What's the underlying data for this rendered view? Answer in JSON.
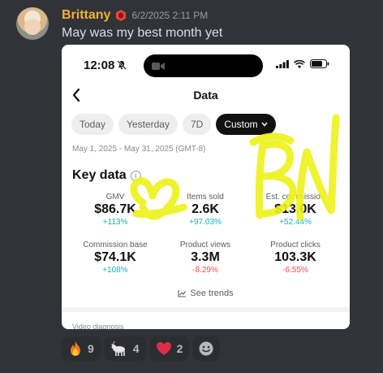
{
  "message": {
    "username": "Brittany",
    "timestamp": "6/2/2025 2:11 PM",
    "text": "May was my best month yet"
  },
  "screenshot": {
    "status_bar": {
      "time": "12:08"
    },
    "nav": {
      "title": "Data"
    },
    "tabs": [
      {
        "label": "Today"
      },
      {
        "label": "Yesterday"
      },
      {
        "label": "7D"
      },
      {
        "label": "Custom"
      }
    ],
    "date_range": "May 1, 2025 - May 31, 2025 (GMT-8)",
    "section_title": "Key data",
    "metrics": [
      {
        "label": "GMV",
        "value": "$86.7K",
        "change": "+113%",
        "direction": "up"
      },
      {
        "label": "Items sold",
        "value": "2.6K",
        "change": "+97.03%",
        "direction": "up"
      },
      {
        "label": "Est. commission",
        "value": "$13.0K",
        "change": "+52.44%",
        "direction": "up"
      },
      {
        "label": "Commission base",
        "value": "$74.1K",
        "change": "+108%",
        "direction": "up"
      },
      {
        "label": "Product views",
        "value": "3.3M",
        "change": "-8.29%",
        "direction": "down"
      },
      {
        "label": "Product clicks",
        "value": "103.3K",
        "change": "-6.55%",
        "direction": "down"
      }
    ],
    "see_trends": "See trends",
    "next_section": "Video diagnosis",
    "colors": {
      "positive": "#18b2b4",
      "negative": "#f04a4a",
      "scribble": "#eef218"
    }
  },
  "reactions": [
    {
      "icon": "fire-icon",
      "count": "9"
    },
    {
      "icon": "goat-icon",
      "count": "4"
    },
    {
      "icon": "heart-icon",
      "count": "2"
    }
  ],
  "colors": {
    "username": "#f0b232",
    "background": "#313338"
  }
}
